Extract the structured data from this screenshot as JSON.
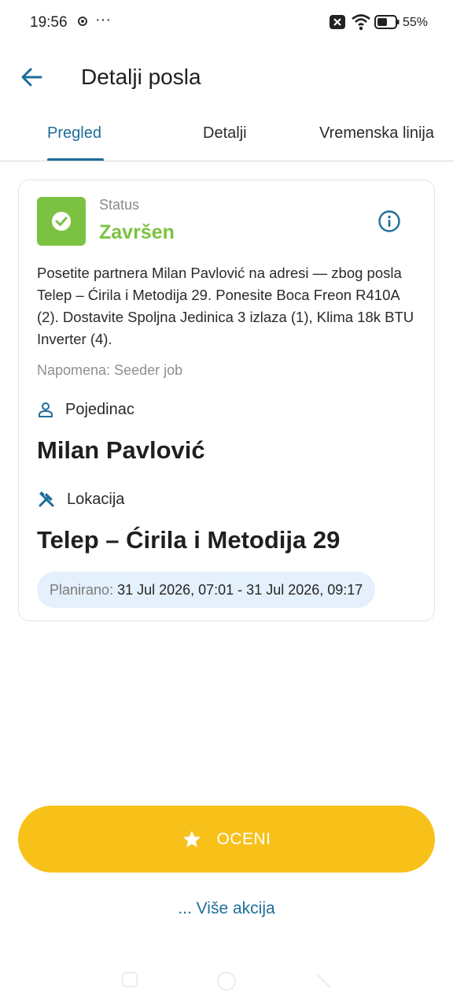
{
  "status_bar": {
    "time": "19:56",
    "more": "···",
    "battery": "55%"
  },
  "header": {
    "title": "Detalji posla"
  },
  "tabs": [
    {
      "label": "Pregled",
      "active": true
    },
    {
      "label": "Detalji",
      "active": false
    },
    {
      "label": "Vremenska linija",
      "active": false
    }
  ],
  "card": {
    "status_label": "Status",
    "status_value": "Završen",
    "description": "Posetite partnera Milan Pavlović na adresi — zbog posla Telep – Ćirila i Metodija 29. Ponesite Boca Freon R410A (2). Dostavite Spoljna Jedinica 3 izlaza (1), Klima 18k BTU Inverter (4).",
    "note": "Napomena: Seeder job",
    "person_section": "Pojedinac",
    "person_name": "Milan Pavlović",
    "location_section": "Lokacija",
    "location_name": "Telep – Ćirila i Metodija 29",
    "planned_label": "Planirano:",
    "planned_value": "31 Jul 2026, 07:01 - 31 Jul 2026, 09:17"
  },
  "actions": {
    "rate_label": "OCENI",
    "more_label": "... Više akcija"
  },
  "colors": {
    "accent": "#1e6d9b",
    "status_green": "#7cc242",
    "rate_button": "#f7c11a",
    "planned_bg": "#e4f0fb"
  }
}
